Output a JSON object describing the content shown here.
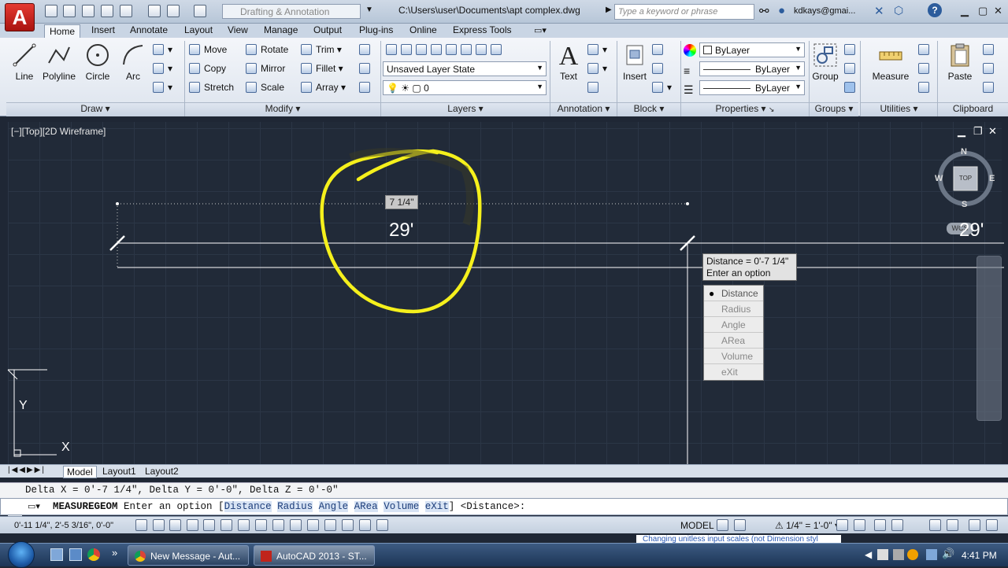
{
  "titlebar": {
    "app_button": "A",
    "workspace": "Drafting & Annotation",
    "filepath": "C:\\Users\\user\\Documents\\apt complex.dwg",
    "search_placeholder": "Type a keyword or phrase",
    "user": "kdkays@gmai...",
    "help": "?"
  },
  "tabs": [
    "Home",
    "Insert",
    "Annotate",
    "Layout",
    "View",
    "Manage",
    "Output",
    "Plug-ins",
    "Online",
    "Express Tools"
  ],
  "ribbon": {
    "draw": {
      "title": "Draw",
      "line": "Line",
      "polyline": "Polyline",
      "circle": "Circle",
      "arc": "Arc"
    },
    "modify": {
      "title": "Modify",
      "move": "Move",
      "rotate": "Rotate",
      "trim": "Trim",
      "copy": "Copy",
      "mirror": "Mirror",
      "fillet": "Fillet",
      "stretch": "Stretch",
      "scale": "Scale",
      "array": "Array"
    },
    "layers": {
      "title": "Layers",
      "layer_state": "Unsaved Layer State",
      "current_layer": "0"
    },
    "annotation": {
      "title": "Annotation",
      "text": "Text"
    },
    "block": {
      "title": "Block",
      "insert": "Insert"
    },
    "properties": {
      "title": "Properties",
      "color": "ByLayer",
      "linetype": "ByLayer",
      "lineweight": "ByLayer"
    },
    "groups": {
      "title": "Groups",
      "group": "Group"
    },
    "utilities": {
      "title": "Utilities",
      "measure": "Measure"
    },
    "clipboard": {
      "title": "Clipboard",
      "paste": "Paste"
    }
  },
  "viewport": {
    "label": "[−][Top][2D Wireframe]",
    "dim_value": "7 1/4\"",
    "dim_text": "29'",
    "dim_text_right": "29'",
    "compass": {
      "n": "N",
      "s": "S",
      "e": "E",
      "w": "W",
      "cube": "TOP",
      "wcs": "WCS"
    },
    "ucs_x": "X",
    "ucs_y": "Y"
  },
  "tooltip": {
    "line1": "Distance = 0'-7 1/4\"",
    "line2": "Enter an option"
  },
  "options": [
    "Distance",
    "Radius",
    "Angle",
    "ARea",
    "Volume",
    "eXit"
  ],
  "selected_option": "Distance",
  "layout_tabs": [
    "Model",
    "Layout1",
    "Layout2"
  ],
  "command": {
    "history": "Delta X = 0'-7 1/4\",  Delta Y = 0'-0\",   Delta Z = 0'-0\"",
    "name": "MEASUREGEOM",
    "prompt": "Enter an option [",
    "keywords": [
      "Distance",
      "Radius",
      "Angle",
      "ARea",
      "Volume",
      "eXit"
    ],
    "suffix": "] <Distance>:"
  },
  "statusbar": {
    "coords": "0'-11 1/4\", 2'-5 3/16\", 0'-0\"",
    "model": "MODEL",
    "scale": "1/4\" = 1'-0\""
  },
  "taskbar": {
    "tasks": [
      "New Message - Aut...",
      "AutoCAD 2013 - ST..."
    ],
    "clock": "4:41 PM",
    "peek": "Changing unitless input scales (not Dimension styl"
  }
}
